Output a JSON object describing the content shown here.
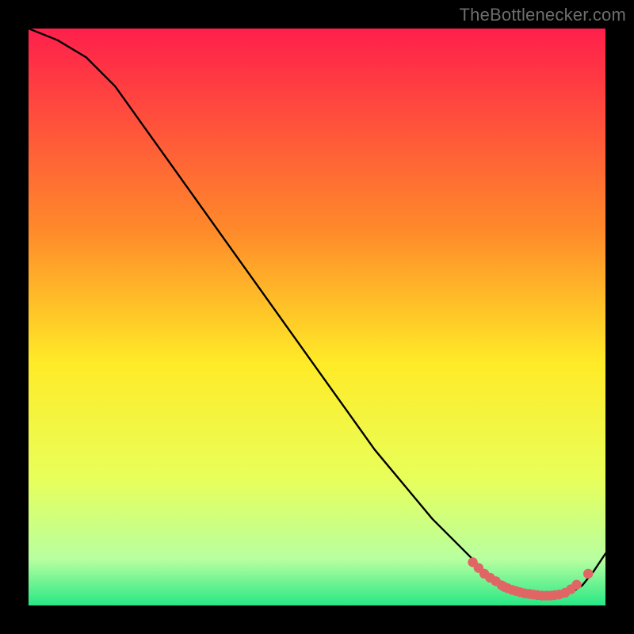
{
  "watermark": "TheBottlenecker.com",
  "colors": {
    "top": "#ff1f4b",
    "mid_upper": "#ff8a2a",
    "mid": "#ffeb27",
    "mid_lower": "#e8ff5a",
    "near_bottom": "#b8ffa0",
    "bottom": "#27e884",
    "curve": "#000000",
    "marker": "#e06666",
    "frame": "#000000"
  },
  "chart_data": {
    "type": "line",
    "title": "",
    "xlabel": "",
    "ylabel": "",
    "xlim": [
      0,
      100
    ],
    "ylim": [
      0,
      100
    ],
    "series": [
      {
        "name": "bottleneck-curve",
        "x": [
          0,
          5,
          10,
          15,
          20,
          25,
          30,
          35,
          40,
          45,
          50,
          55,
          60,
          65,
          70,
          75,
          78,
          80,
          82,
          84,
          86,
          88,
          90,
          92,
          94,
          96,
          98,
          100
        ],
        "y": [
          100,
          98,
          95,
          90,
          83,
          76,
          69,
          62,
          55,
          48,
          41,
          34,
          27,
          21,
          15,
          10,
          7,
          5,
          3.5,
          2.5,
          2,
          1.7,
          1.6,
          1.7,
          2.2,
          3.5,
          6,
          9
        ]
      }
    ],
    "markers": {
      "name": "scatter-markers",
      "points": [
        {
          "x": 77,
          "y": 7.5
        },
        {
          "x": 78,
          "y": 6.5
        },
        {
          "x": 79,
          "y": 5.5
        },
        {
          "x": 80,
          "y": 4.8
        },
        {
          "x": 81,
          "y": 4.2
        },
        {
          "x": 82,
          "y": 3.5
        },
        {
          "x": 82.5,
          "y": 3.2
        },
        {
          "x": 83,
          "y": 3.0
        },
        {
          "x": 83.8,
          "y": 2.7
        },
        {
          "x": 84.5,
          "y": 2.5
        },
        {
          "x": 85.2,
          "y": 2.3
        },
        {
          "x": 86,
          "y": 2.1
        },
        {
          "x": 86.8,
          "y": 2.0
        },
        {
          "x": 87.5,
          "y": 1.9
        },
        {
          "x": 88.2,
          "y": 1.8
        },
        {
          "x": 89,
          "y": 1.7
        },
        {
          "x": 89.8,
          "y": 1.7
        },
        {
          "x": 90.5,
          "y": 1.7
        },
        {
          "x": 91.2,
          "y": 1.8
        },
        {
          "x": 92,
          "y": 1.9
        },
        {
          "x": 93,
          "y": 2.2
        },
        {
          "x": 94,
          "y": 2.8
        },
        {
          "x": 95,
          "y": 3.6
        },
        {
          "x": 97,
          "y": 5.5
        }
      ]
    },
    "gradient_stops": [
      {
        "offset": 0.0,
        "key": "top"
      },
      {
        "offset": 0.35,
        "key": "mid_upper"
      },
      {
        "offset": 0.58,
        "key": "mid"
      },
      {
        "offset": 0.78,
        "key": "mid_lower"
      },
      {
        "offset": 0.92,
        "key": "near_bottom"
      },
      {
        "offset": 1.0,
        "key": "bottom"
      }
    ]
  }
}
